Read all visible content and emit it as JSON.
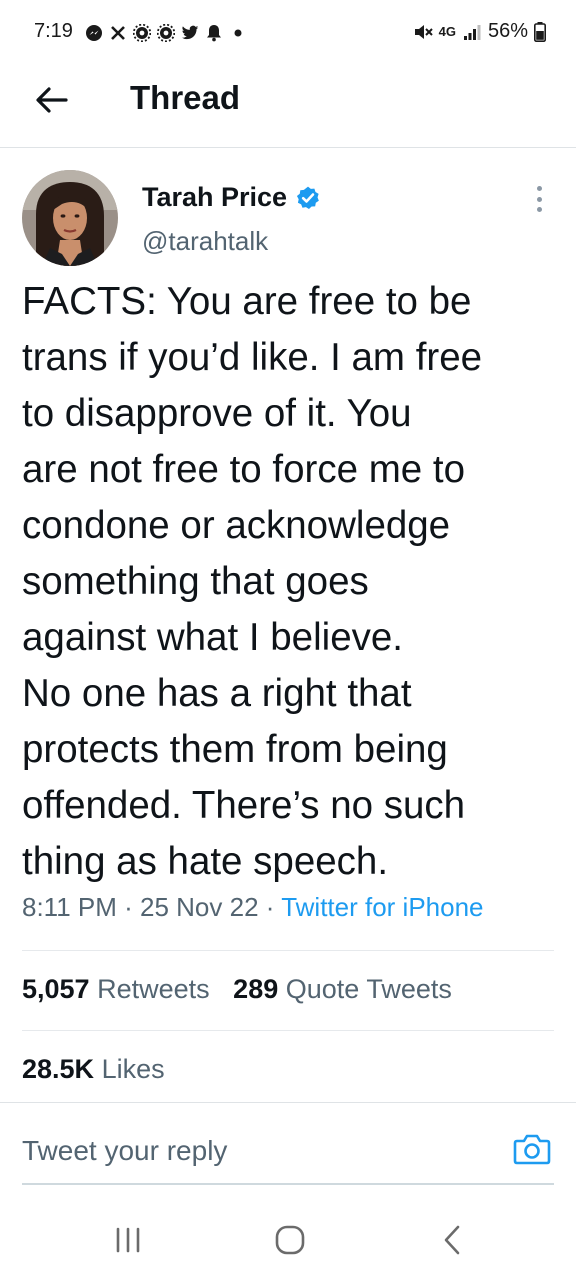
{
  "status_bar": {
    "time": "7:19",
    "network": "4G",
    "battery": "56%",
    "left_icons": [
      "messenger-icon",
      "x-icon",
      "settings-icon",
      "settings-icon",
      "twitter-icon",
      "notification-bell-icon",
      "dot-icon"
    ]
  },
  "header": {
    "title": "Thread"
  },
  "tweet": {
    "author_name": "Tarah Price",
    "author_handle": "@tarahtalk",
    "verified": true,
    "text": "FACTS: You are free to be\ntrans if you’d like. I am free\nto disapprove of it. You\nare not free to force me to\ncondone or acknowledge\nsomething that goes\nagainst what I believe.\nNo one has a right that\nprotects them from being\noffended. There’s no such\nthing as hate speech.",
    "time": "8:11 PM",
    "date": "25 Nov 22",
    "source": "Twitter for iPhone",
    "separator": " · "
  },
  "stats": {
    "retweets_count": "5,057",
    "retweets_label": "Retweets",
    "quotes_count": "289",
    "quotes_label": "Quote Tweets",
    "likes_count": "28.5K",
    "likes_label": "Likes"
  },
  "reply": {
    "placeholder": "Tweet your reply"
  },
  "colors": {
    "accent": "#1d9bf0",
    "text_primary": "#0f1419",
    "text_secondary": "#536471",
    "divider": "#e6e9ec"
  }
}
